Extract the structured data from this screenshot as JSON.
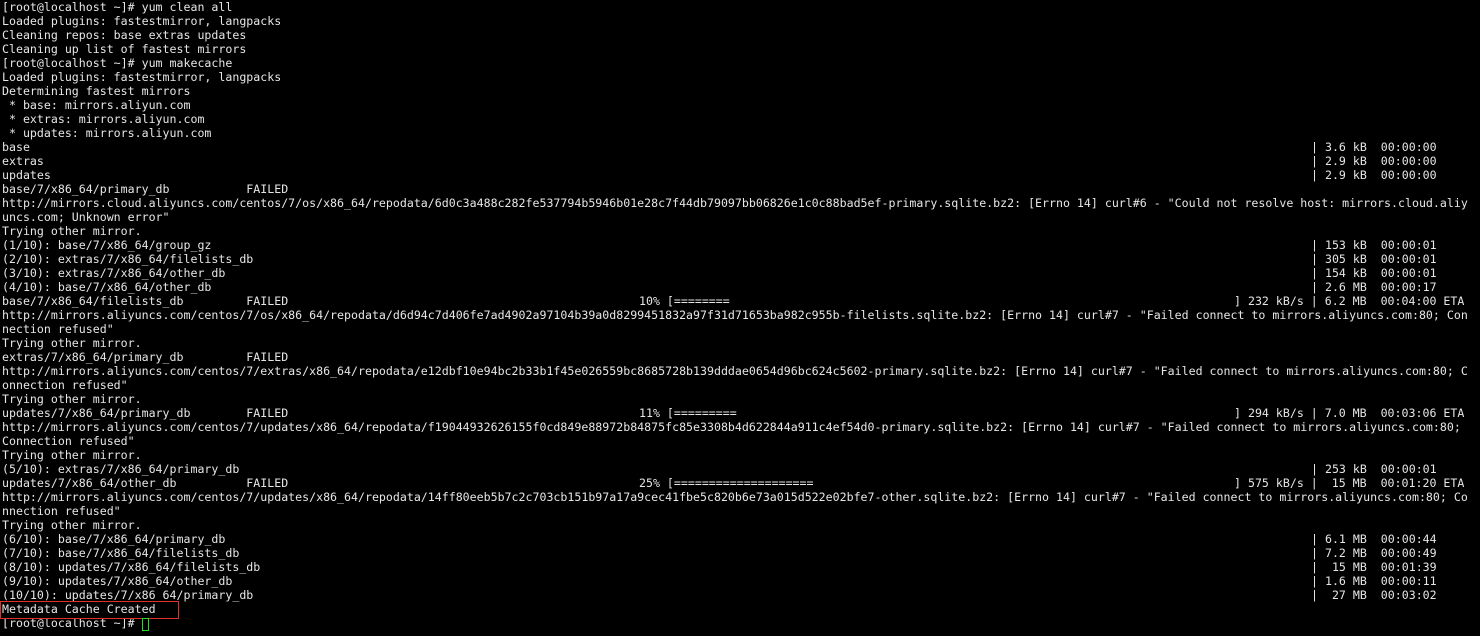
{
  "terminal": {
    "colors": {
      "background": "#000000",
      "text": "#e6e6e6",
      "highlight_box": "#e0302a",
      "cursor": "#19e619"
    },
    "lines": [
      {
        "text": "[root@localhost ~]# yum clean all"
      },
      {
        "text": "Loaded plugins: fastestmirror, langpacks"
      },
      {
        "text": "Cleaning repos: base extras updates"
      },
      {
        "text": "Cleaning up list of fastest mirrors"
      },
      {
        "text": "[root@localhost ~]# yum makecache"
      },
      {
        "text": "Loaded plugins: fastestmirror, langpacks"
      },
      {
        "text": "Determining fastest mirrors"
      },
      {
        "text": " * base: mirrors.aliyun.com"
      },
      {
        "text": " * extras: mirrors.aliyun.com"
      },
      {
        "text": " * updates: mirrors.aliyun.com"
      },
      {
        "text": "base",
        "size": "| 3.6 kB  00:00:00"
      },
      {
        "text": "extras",
        "size": "| 2.9 kB  00:00:00"
      },
      {
        "text": "updates",
        "size": "| 2.9 kB  00:00:00"
      },
      {
        "text": "base/7/x86_64/primary_db           FAILED"
      },
      {
        "text": "http://mirrors.cloud.aliyuncs.com/centos/7/os/x86_64/repodata/6d0c3a488c282fe537794b5946b01e28c7f44db79097bb06826e1c0c88bad5ef-primary.sqlite.bz2: [Errno 14] curl#6 - \"Could not resolve host: mirrors.cloud.aliy"
      },
      {
        "text": "uncs.com; Unknown error\""
      },
      {
        "text": "Trying other mirror."
      },
      {
        "text": "(1/10): base/7/x86_64/group_gz",
        "size": "| 153 kB  00:00:01"
      },
      {
        "text": "(2/10): extras/7/x86_64/filelists_db",
        "size": "| 305 kB  00:00:01"
      },
      {
        "text": "(3/10): extras/7/x86_64/other_db",
        "size": "| 154 kB  00:00:01"
      },
      {
        "text": "(4/10): base/7/x86_64/other_db",
        "size": "| 2.6 MB  00:00:17"
      },
      {
        "text": "base/7/x86_64/filelists_db         FAILED",
        "pct": "10% [========",
        "rate": "] 232 kB/s | 6.2 MB  00:04:00 ETA"
      },
      {
        "text": "http://mirrors.aliyuncs.com/centos/7/os/x86_64/repodata/d6d94c7d406fe7ad4902a97104b39a0d8299451832a97f31d71653ba982c955b-filelists.sqlite.bz2: [Errno 14] curl#7 - \"Failed connect to mirrors.aliyuncs.com:80; Con"
      },
      {
        "text": "nection refused\""
      },
      {
        "text": "Trying other mirror."
      },
      {
        "text": "extras/7/x86_64/primary_db         FAILED"
      },
      {
        "text": "http://mirrors.aliyuncs.com/centos/7/extras/x86_64/repodata/e12dbf10e94bc2b33b1f45e026559bc8685728b139dddae0654d96bc624c5602-primary.sqlite.bz2: [Errno 14] curl#7 - \"Failed connect to mirrors.aliyuncs.com:80; C"
      },
      {
        "text": "onnection refused\""
      },
      {
        "text": "Trying other mirror."
      },
      {
        "text": "updates/7/x86_64/primary_db        FAILED",
        "pct": "11% [=========",
        "rate": "] 294 kB/s | 7.0 MB  00:03:06 ETA"
      },
      {
        "text": "http://mirrors.aliyuncs.com/centos/7/updates/x86_64/repodata/f19044932626155f0cd849e88972b84875fc85e3308b4d622844a911c4ef54d0-primary.sqlite.bz2: [Errno 14] curl#7 - \"Failed connect to mirrors.aliyuncs.com:80;"
      },
      {
        "text": "Connection refused\""
      },
      {
        "text": "Trying other mirror."
      },
      {
        "text": "(5/10): extras/7/x86_64/primary_db",
        "size": "| 253 kB  00:00:01"
      },
      {
        "text": "updates/7/x86_64/other_db          FAILED",
        "pct": "25% [====================",
        "rate": "] 575 kB/s |  15 MB  00:01:20 ETA"
      },
      {
        "text": "http://mirrors.aliyuncs.com/centos/7/updates/x86_64/repodata/14ff80eeb5b7c2c703cb151b97a17a9cec41fbe5c820b6e73a015d522e02bfe7-other.sqlite.bz2: [Errno 14] curl#7 - \"Failed connect to mirrors.aliyuncs.com:80; Co"
      },
      {
        "text": "nnection refused\""
      },
      {
        "text": "Trying other mirror."
      },
      {
        "text": "(6/10): base/7/x86_64/primary_db",
        "size": "| 6.1 MB  00:00:44"
      },
      {
        "text": "(7/10): base/7/x86_64/filelists_db",
        "size": "| 7.2 MB  00:00:49"
      },
      {
        "text": "(8/10): updates/7/x86_64/filelists_db",
        "size": "|  15 MB  00:01:39"
      },
      {
        "text": "(9/10): updates/7/x86_64/other_db",
        "size": "| 1.6 MB  00:00:11"
      },
      {
        "text": "(10/10): updates/7/x86_64/primary_db",
        "size": "|  27 MB  00:03:02"
      },
      {
        "text": "Metadata Cache Created"
      },
      {
        "text": "[root@localhost ~]# "
      }
    ]
  }
}
